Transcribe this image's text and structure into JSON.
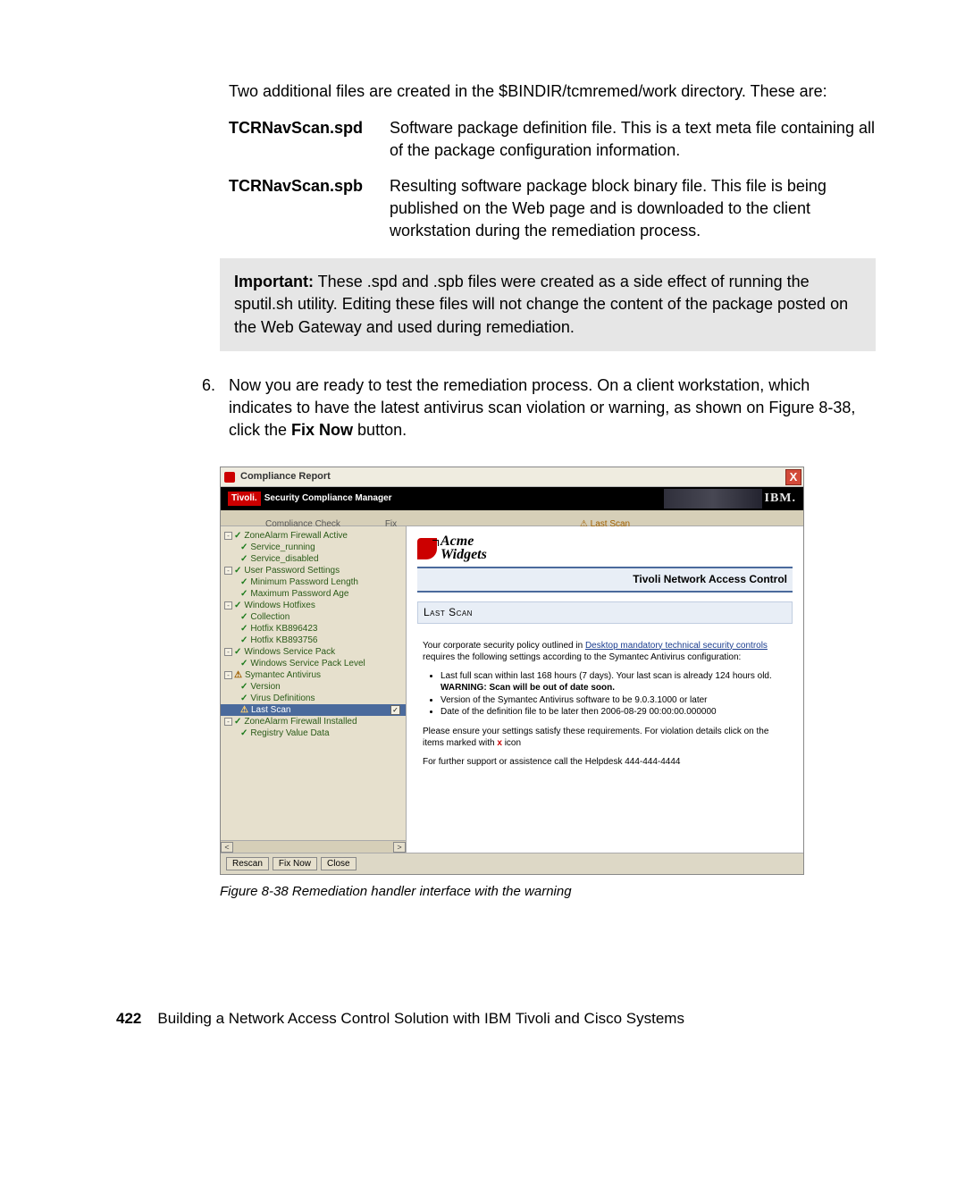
{
  "intro": "Two additional files are created in the $BINDIR/tcmremed/work directory. These are:",
  "defs": [
    {
      "term": "TCRNavScan.spd",
      "desc": "Software package definition file. This is a text meta file containing all of the package configuration information."
    },
    {
      "term": "TCRNavScan.spb",
      "desc": "Resulting software package block binary file. This file is being published on the Web page and is downloaded to the client workstation during the remediation process."
    }
  ],
  "note_label": "Important:",
  "note_body": " These .spd and .spb files were created as a side effect of running the sputil.sh utility. Editing these files will not change the content of the package posted on the Web Gateway and used during remediation.",
  "step_num": "6.",
  "step_text_a": "Now you are ready to test the remediation process. On a client workstation, which indicates to have the latest antivirus scan violation or warning, as shown on Figure 8-38, click the ",
  "step_bold": "Fix Now",
  "step_text_b": " button.",
  "screenshot": {
    "title": "Compliance Report",
    "close": "X",
    "brand_box": "Tivoli.",
    "brand_rest": "Security Compliance Manager",
    "ibm": "IBM.",
    "col_check": "Compliance Check",
    "col_fixnow": "Fix Now",
    "col_right": "Last Scan",
    "tree": [
      {
        "toggle": "-",
        "indent": 0,
        "status": "ok",
        "label": "ZoneAlarm Firewall Active"
      },
      {
        "indent": 1,
        "status": "ok",
        "label": "Service_running"
      },
      {
        "indent": 1,
        "status": "ok",
        "label": "Service_disabled"
      },
      {
        "toggle": "-",
        "indent": 0,
        "status": "ok",
        "label": "User Password Settings"
      },
      {
        "indent": 1,
        "status": "ok",
        "label": "Minimum Password Length"
      },
      {
        "indent": 1,
        "status": "ok",
        "label": "Maximum Password Age"
      },
      {
        "toggle": "-",
        "indent": 0,
        "status": "ok",
        "label": "Windows Hotfixes"
      },
      {
        "indent": 1,
        "status": "ok",
        "label": "Collection"
      },
      {
        "indent": 1,
        "status": "ok",
        "label": "Hotfix KB896423"
      },
      {
        "indent": 1,
        "status": "ok",
        "label": "Hotfix KB893756"
      },
      {
        "toggle": "-",
        "indent": 0,
        "status": "ok",
        "label": "Windows Service Pack"
      },
      {
        "indent": 1,
        "status": "ok",
        "label": "Windows Service Pack Level"
      },
      {
        "toggle": "-",
        "indent": 0,
        "status": "warn",
        "label": "Symantec Antivirus"
      },
      {
        "indent": 1,
        "status": "ok",
        "label": "Version"
      },
      {
        "indent": 1,
        "status": "ok",
        "label": "Virus Definitions"
      },
      {
        "indent": 1,
        "status": "warn",
        "label": "Last Scan",
        "selected": true,
        "checkbox": true
      },
      {
        "toggle": "-",
        "indent": 0,
        "status": "ok",
        "label": "ZoneAlarm Firewall Installed"
      },
      {
        "indent": 1,
        "status": "ok",
        "label": "Registry Value Data"
      }
    ],
    "scroll_left": "<",
    "scroll_right": ">",
    "content": {
      "acme1": "Acme",
      "acme2": "Widgets",
      "tnac": "Tivoli Network Access Control",
      "section": "Last Scan",
      "p1a": "Your corporate security policy outlined in ",
      "p1link": "Desktop mandatory technical security controls",
      "p1b": " requires the following settings according to the Symantec Antivirus configuration:",
      "bullets": [
        {
          "text": "Last full scan within last 168 hours (7 days). Your last scan is already 124 hours old.",
          "warn": "WARNING: Scan will be out of date soon."
        },
        {
          "text": "Version of the Symantec Antivirus software to be 9.0.3.1000 or later"
        },
        {
          "text": "Date of the definition file to be later then 2006-08-29 00:00:00.000000"
        }
      ],
      "p2a": "Please ensure your settings satisfy these requirements. For violation details click on the items marked with ",
      "p2x": "x",
      "p2b": " icon",
      "help": "For further support or assistence call the Helpdesk 444-444-4444"
    },
    "buttons": {
      "rescan": "Rescan",
      "fixnow": "Fix Now",
      "close": "Close"
    }
  },
  "figcap": "Figure 8-38   Remediation handler interface with the warning",
  "footer": {
    "page": "422",
    "title": "Building a Network Access Control Solution with IBM Tivoli and Cisco Systems"
  }
}
